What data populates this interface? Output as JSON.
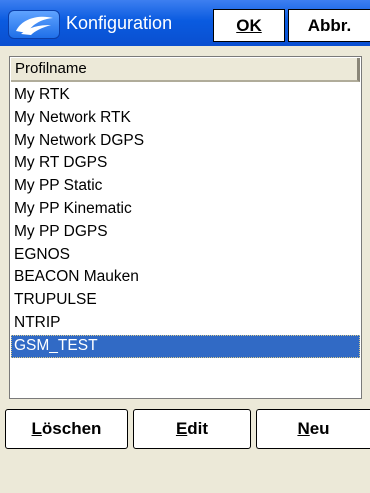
{
  "window": {
    "title": "Konfiguration",
    "ok_label": "OK",
    "abbr_label": "Abbr.",
    "logo_icon": "satellite-swoosh-icon"
  },
  "list": {
    "column_header": "Profilname",
    "items": [
      "My RTK",
      "My Network RTK",
      "My Network DGPS",
      "My RT DGPS",
      "My PP Static",
      "My PP Kinematic",
      "My PP DGPS",
      "EGNOS",
      "BEACON Mauken",
      "TRUPULSE",
      "NTRIP",
      "GSM_TEST"
    ],
    "selected_item": "GSM_TEST"
  },
  "buttons": {
    "delete_label": "Löschen",
    "edit_label": "Edit",
    "new_label": "Neu"
  },
  "colors": {
    "titlebar": "#0a5be0",
    "selection": "#316ac5",
    "background": "#ece9d8"
  }
}
